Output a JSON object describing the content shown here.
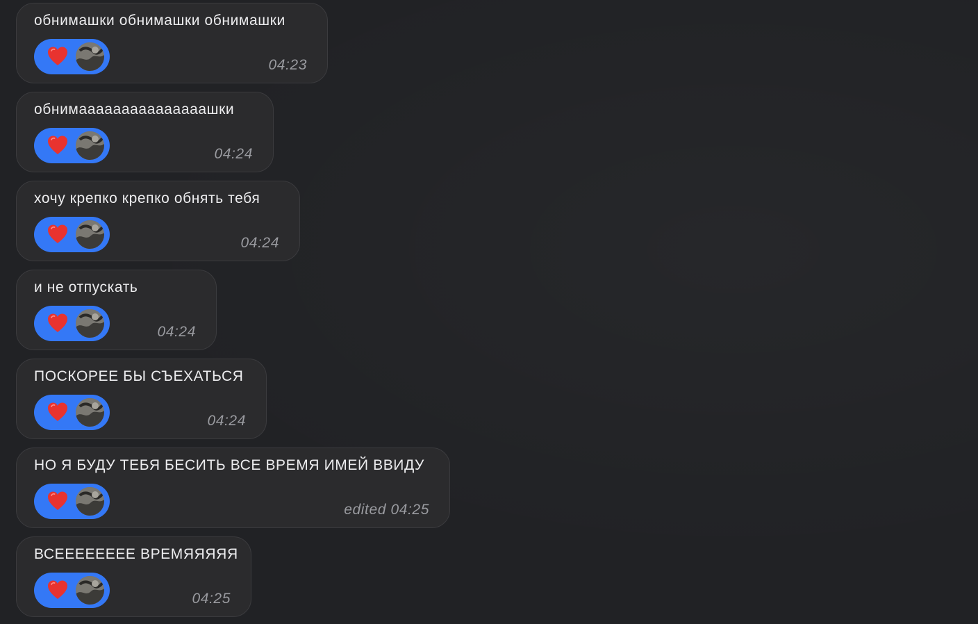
{
  "messages": [
    {
      "text": "обнимашки обнимашки обнимашки",
      "reaction": {
        "emoji": "heart",
        "icon": "heart-icon",
        "reactor": "avatar"
      },
      "time": "04:23"
    },
    {
      "text": "обнимааааааааааааааашки",
      "reaction": {
        "emoji": "heart",
        "icon": "heart-icon",
        "reactor": "avatar"
      },
      "time": "04:24"
    },
    {
      "text": "хочу крепко крепко обнять тебя",
      "reaction": {
        "emoji": "heart",
        "icon": "heart-icon",
        "reactor": "avatar"
      },
      "time": "04:24"
    },
    {
      "text": "и не отпускать",
      "reaction": {
        "emoji": "heart",
        "icon": "heart-icon",
        "reactor": "avatar"
      },
      "time": "04:24"
    },
    {
      "text": "ПОСКОРЕЕ БЫ СЪЕХАТЬСЯ",
      "reaction": {
        "emoji": "heart",
        "icon": "heart-icon",
        "reactor": "avatar"
      },
      "time": "04:24"
    },
    {
      "text": "НО Я БУДУ ТЕБЯ БЕСИТЬ ВСЕ ВРЕМЯ ИМЕЙ ВВИДУ",
      "reaction": {
        "emoji": "heart",
        "icon": "heart-icon",
        "reactor": "avatar"
      },
      "time": "edited 04:25"
    },
    {
      "text": "ВСЕЕЕЕЕЕЕЕ ВРЕМЯЯЯЯЯ",
      "reaction": {
        "emoji": "heart",
        "icon": "heart-icon",
        "reactor": "avatar"
      },
      "time": "04:25"
    }
  ],
  "colors": {
    "background": "#212225",
    "bubble": "#2b2b2d",
    "bubble_border": "#3b3b3e",
    "reaction_pill": "#3478f6",
    "heart": "#e8332f",
    "text": "#ececee",
    "timestamp": "#9a9ba0"
  }
}
